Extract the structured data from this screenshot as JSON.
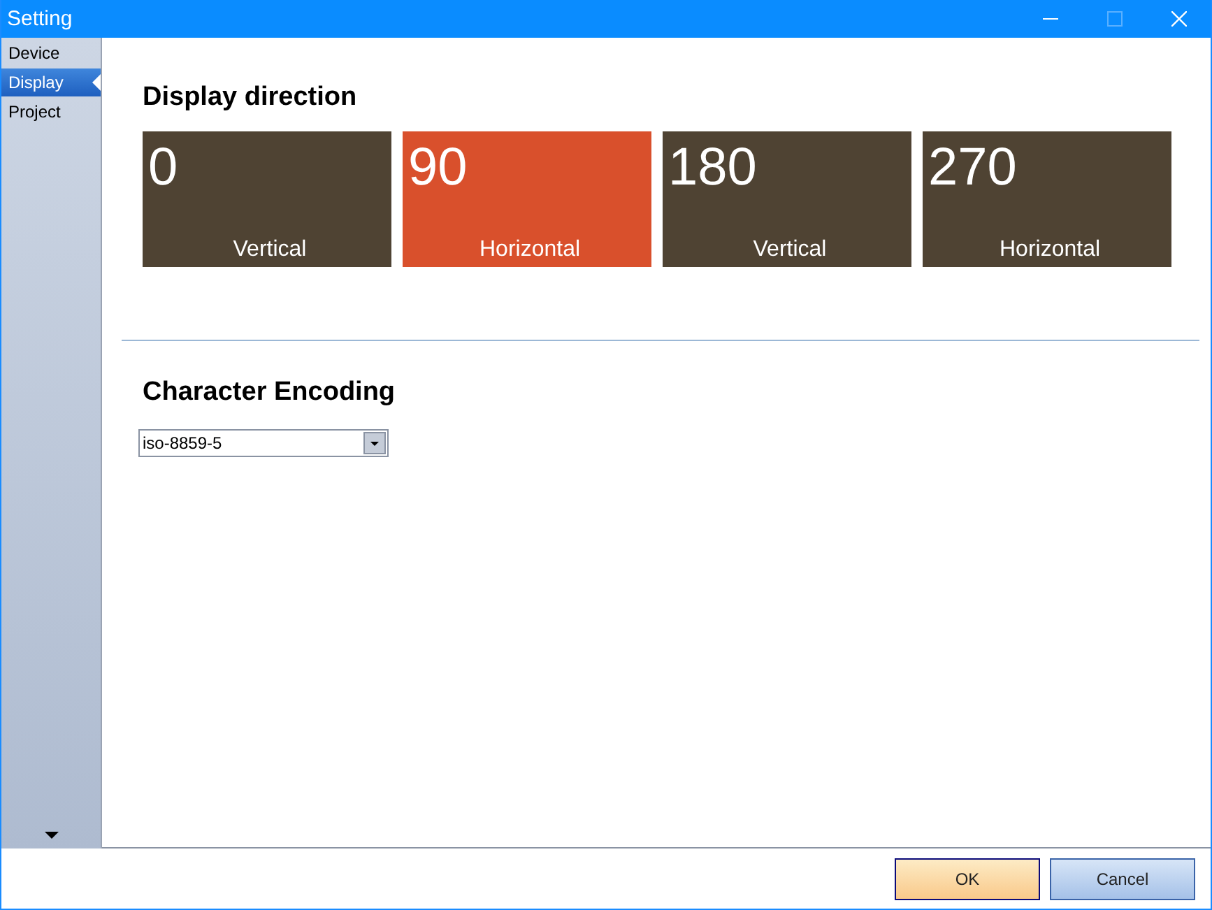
{
  "window": {
    "title": "Setting"
  },
  "sidebar": {
    "items": [
      {
        "label": "Device",
        "selected": false
      },
      {
        "label": "Display",
        "selected": true
      },
      {
        "label": "Project",
        "selected": false
      }
    ]
  },
  "display_direction": {
    "heading": "Display direction",
    "options": [
      {
        "angle": "0",
        "label": "Vertical",
        "selected": false
      },
      {
        "angle": "90",
        "label": "Horizontal",
        "selected": true
      },
      {
        "angle": "180",
        "label": "Vertical",
        "selected": false
      },
      {
        "angle": "270",
        "label": "Horizontal",
        "selected": false
      }
    ]
  },
  "character_encoding": {
    "heading": "Character Encoding",
    "value": "iso-8859-5"
  },
  "buttons": [
    {
      "label": "OK",
      "kind": "primary"
    },
    {
      "label": "Cancel",
      "kind": "secondary"
    }
  ]
}
